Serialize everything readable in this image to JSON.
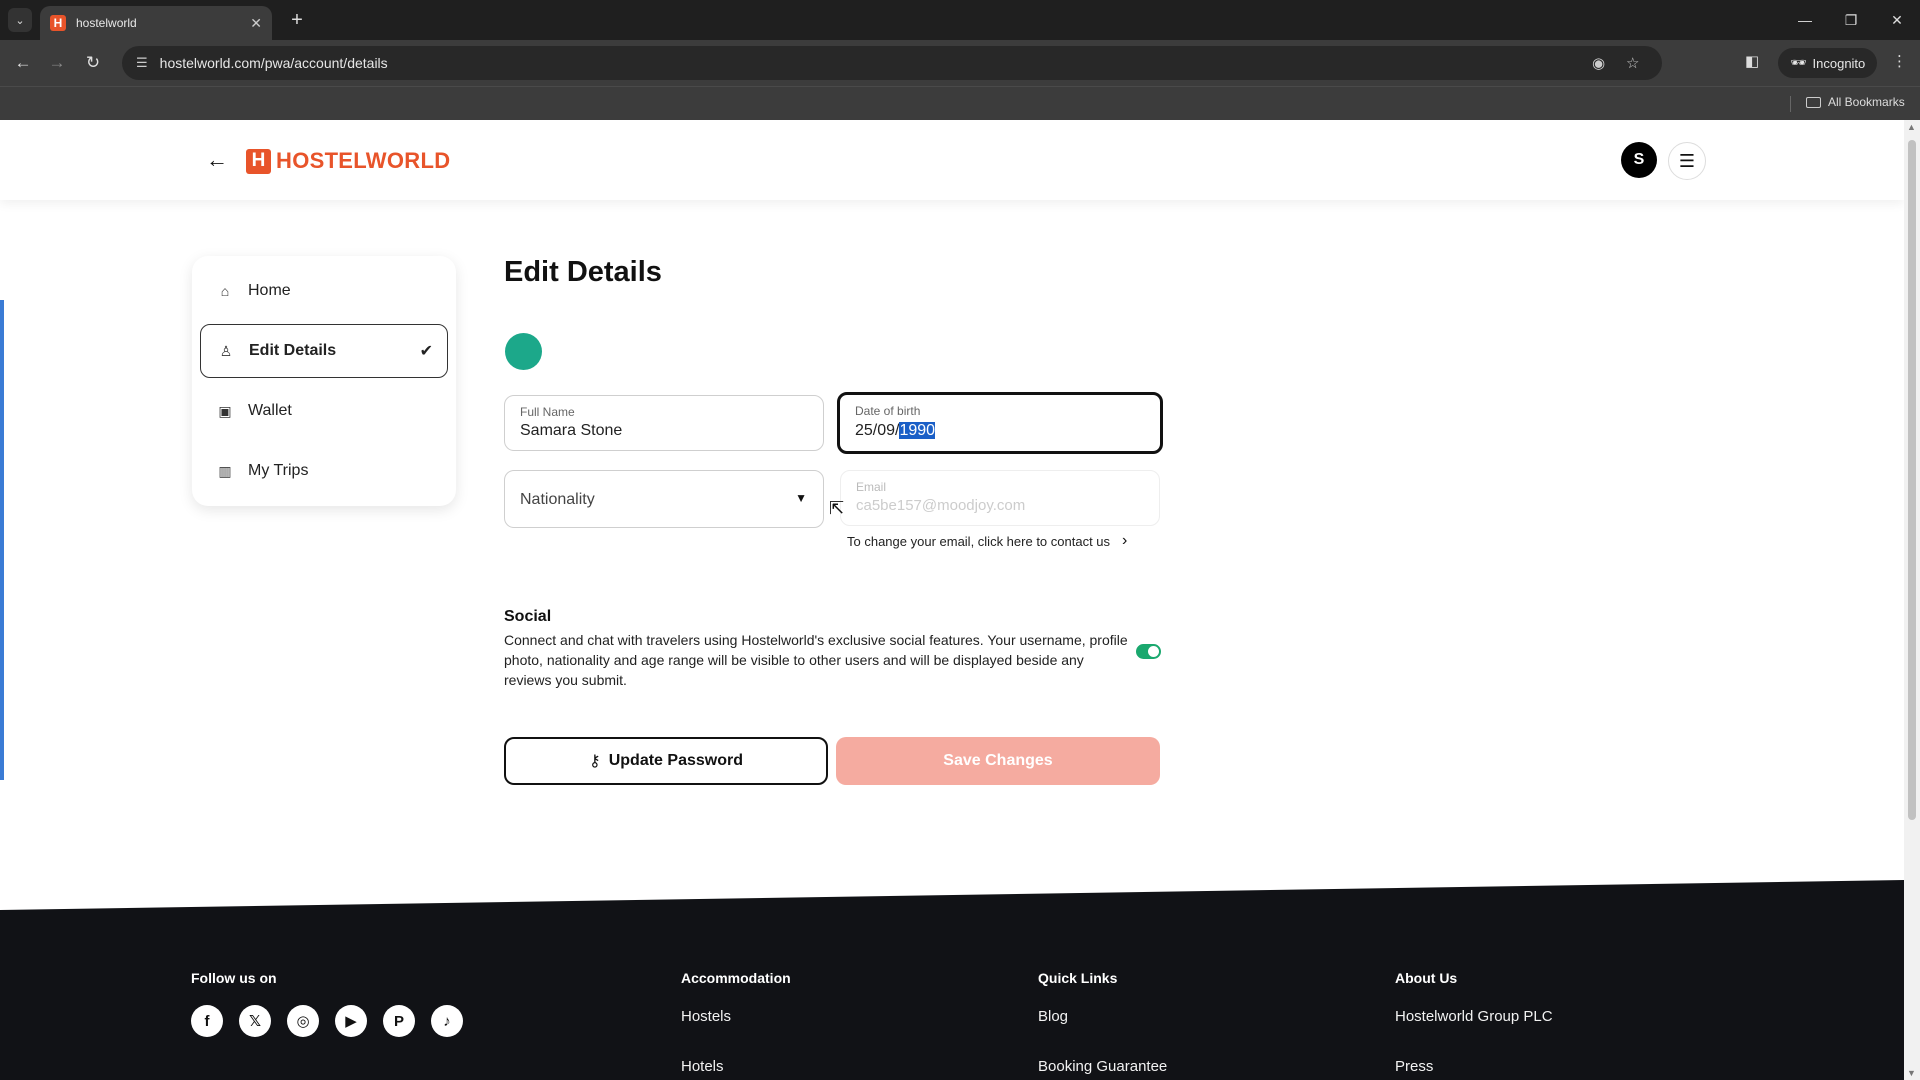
{
  "browser": {
    "tab_title": "hostelworld",
    "tab_favicon": "H",
    "url": "hostelworld.com/pwa/account/details",
    "incognito_label": "Incognito",
    "all_bookmarks_label": "All Bookmarks"
  },
  "header": {
    "logo_mark": "H",
    "logo_text": "HOSTELWORLD",
    "avatar_initial": "S"
  },
  "sidebar": {
    "items": [
      {
        "label": "Home",
        "icon": "home-icon"
      },
      {
        "label": "Edit Details",
        "icon": "user-icon",
        "active": true
      },
      {
        "label": "Wallet",
        "icon": "wallet-icon"
      },
      {
        "label": "My Trips",
        "icon": "map-icon"
      }
    ]
  },
  "form": {
    "title": "Edit Details",
    "full_name_label": "Full Name",
    "full_name_value": "Samara Stone",
    "dob_label": "Date of birth",
    "dob_prefix": "25/09/",
    "dob_selected": "1990",
    "nationality_placeholder": "Nationality",
    "email_label": "Email",
    "email_value": "ca5be157@moodjoy.com",
    "email_note": "To change your email, click here to contact us"
  },
  "social": {
    "title": "Social",
    "description": "Connect and chat with travelers using Hostelworld's exclusive social features. Your username, profile photo, nationality and age range will be visible to other users and will be displayed beside any reviews you submit.",
    "enabled": true
  },
  "actions": {
    "update_password": "Update Password",
    "save_changes": "Save Changes"
  },
  "footer": {
    "follow_title": "Follow us on",
    "social_icons": [
      "facebook-icon",
      "x-icon",
      "instagram-icon",
      "youtube-icon",
      "pinterest-icon",
      "tiktok-icon"
    ],
    "columns": [
      {
        "title": "Accommodation",
        "links": [
          "Hostels",
          "Hotels"
        ]
      },
      {
        "title": "Quick Links",
        "links": [
          "Blog",
          "Booking Guarantee"
        ]
      },
      {
        "title": "About Us",
        "links": [
          "Hostelworld Group PLC",
          "Press"
        ]
      }
    ]
  },
  "colors": {
    "brand": "#e8542a",
    "avatar_teal": "#1ca88a",
    "toggle_on": "#1aa86e",
    "save_disabled": "#f5aba0",
    "footer_bg": "#111216"
  }
}
